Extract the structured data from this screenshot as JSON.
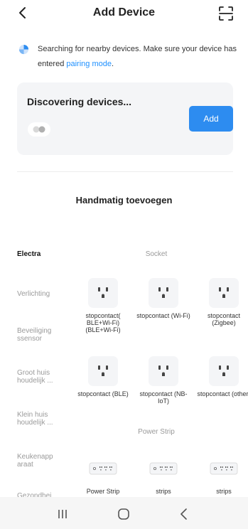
{
  "header": {
    "title": "Add Device"
  },
  "notice": {
    "text": "Searching for nearby devices. Make sure your device has entered",
    "link": "pairing mode",
    "suffix": "."
  },
  "discover": {
    "title": "Discovering devices...",
    "add_label": "Add"
  },
  "manual": {
    "title": "Handmatig toevoegen"
  },
  "categories": [
    {
      "label": "Electra",
      "active": true
    },
    {
      "label": "Verlichting",
      "active": false
    },
    {
      "label": "Beveiliging ssensor",
      "active": false
    },
    {
      "label": "Groot huis houdelijk ...",
      "active": false
    },
    {
      "label": "Klein huis houdelijk ...",
      "active": false
    },
    {
      "label": "Keukenapp araat",
      "active": false
    },
    {
      "label": "Gezondhei",
      "active": false
    }
  ],
  "sections": {
    "socket": "Socket",
    "power_strip": "Power Strip"
  },
  "devices": [
    {
      "label": "stopcontact( BLE+Wi-Fi) (BLE+Wi-Fi)"
    },
    {
      "label": "stopcontact (Wi-Fi)"
    },
    {
      "label": "stopcontact (Zigbee)"
    },
    {
      "label": "stopcontact (BLE)"
    },
    {
      "label": "stopcontact (NB-IoT)"
    },
    {
      "label": "stopcontact (other)"
    },
    {
      "label": "Power Strip"
    },
    {
      "label": "strips"
    },
    {
      "label": "strips"
    }
  ],
  "colors": {
    "accent": "#2d8cf0",
    "link": "#1e90ff",
    "card_bg": "#f4f5f7"
  }
}
